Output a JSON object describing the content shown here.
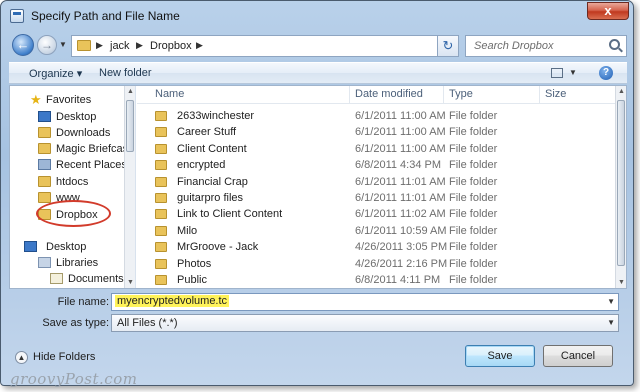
{
  "window": {
    "title": "Specify Path and File Name",
    "close_label": "x"
  },
  "address": {
    "breadcrumbs": [
      "jack",
      "Dropbox"
    ],
    "search_placeholder": "Search Dropbox"
  },
  "toolbar": {
    "organize_label": "Organize ▾",
    "new_folder_label": "New folder",
    "help_label": "?"
  },
  "nav": {
    "items": [
      {
        "label": "Favorites",
        "icon": "star-icon"
      },
      {
        "label": "Desktop",
        "icon": "desktop-icon"
      },
      {
        "label": "Downloads",
        "icon": "folder-icon"
      },
      {
        "label": "Magic Briefcase",
        "icon": "folder-icon"
      },
      {
        "label": "Recent Places",
        "icon": "recent-places-icon"
      },
      {
        "label": "htdocs",
        "icon": "folder-icon"
      },
      {
        "label": "www",
        "icon": "folder-icon"
      },
      {
        "label": "Dropbox",
        "icon": "dropbox-folder-icon"
      },
      {
        "label": "Desktop",
        "icon": "desktop-icon"
      },
      {
        "label": "Libraries",
        "icon": "libraries-icon"
      },
      {
        "label": "Documents",
        "icon": "documents-icon"
      }
    ]
  },
  "files": {
    "columns": [
      "Name",
      "Date modified",
      "Type",
      "Size"
    ],
    "rows": [
      {
        "name": "2633winchester",
        "date": "6/1/2011 11:00 AM",
        "type": "File folder"
      },
      {
        "name": "Career Stuff",
        "date": "6/1/2011 11:00 AM",
        "type": "File folder"
      },
      {
        "name": "Client Content",
        "date": "6/1/2011 11:00 AM",
        "type": "File folder"
      },
      {
        "name": "encrypted",
        "date": "6/8/2011 4:34 PM",
        "type": "File folder"
      },
      {
        "name": "Financial Crap",
        "date": "6/1/2011 11:01 AM",
        "type": "File folder"
      },
      {
        "name": "guitarpro files",
        "date": "6/1/2011 11:01 AM",
        "type": "File folder"
      },
      {
        "name": "Link to Client Content",
        "date": "6/1/2011 11:02 AM",
        "type": "File folder"
      },
      {
        "name": "Milo",
        "date": "6/1/2011 10:59 AM",
        "type": "File folder"
      },
      {
        "name": "MrGroove - Jack",
        "date": "4/26/2011 3:05 PM",
        "type": "File folder"
      },
      {
        "name": "Photos",
        "date": "4/26/2011 2:16 PM",
        "type": "File folder"
      },
      {
        "name": "Public",
        "date": "6/8/2011 4:11 PM",
        "type": "File folder"
      }
    ]
  },
  "form": {
    "filename_label": "File name:",
    "filename_value": "myencryptedvolume.tc",
    "savetype_label": "Save as type:",
    "savetype_value": "All Files (*.*)"
  },
  "footer": {
    "hide_folders_label": "Hide Folders",
    "save_label": "Save",
    "cancel_label": "Cancel"
  },
  "watermark": "groovyPost.com",
  "colors": {
    "highlight_circle": "#d23b2b",
    "filename_highlight": "#fff35a",
    "close_button": "#c0391f"
  }
}
